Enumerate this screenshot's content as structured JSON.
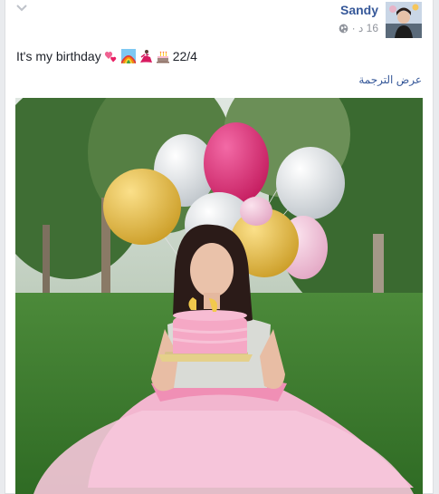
{
  "post": {
    "author": "Sandy",
    "time_meta": "16 د ·",
    "text": "It's my birthday",
    "date_text": "22/4",
    "emojis": [
      "two-hearts-icon",
      "rainbow-icon",
      "dancer-icon",
      "birthday-cake-icon"
    ],
    "see_translation": "عرض الترجمة"
  },
  "colors": {
    "link": "#365899",
    "meta": "#90949c",
    "text": "#1d2129",
    "card_bg": "#ffffff",
    "page_bg": "#e9ebee"
  }
}
